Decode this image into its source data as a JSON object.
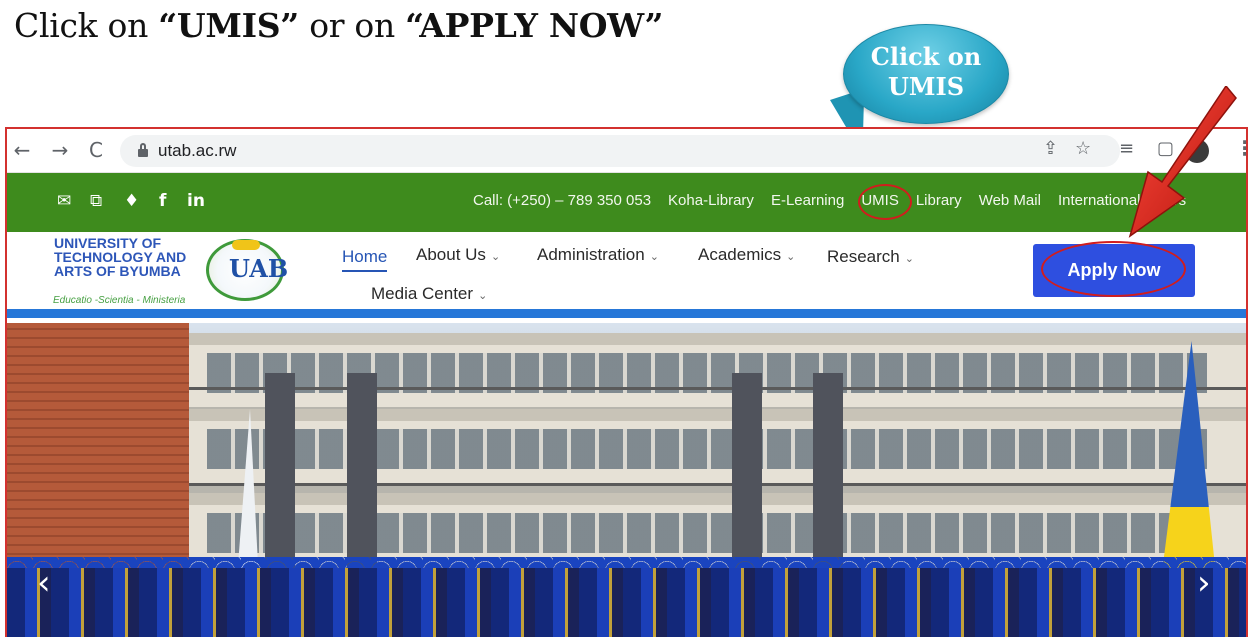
{
  "instruction": {
    "prefix": "Click on ",
    "umis": "“UMIS”",
    "middle": " or on ",
    "apply": "“APPLY NOW”"
  },
  "callout": {
    "line1": "Click on",
    "line2": "UMIS"
  },
  "browser": {
    "back_icon": "←",
    "forward_icon": "→",
    "reload_icon": "C",
    "url": "utab.ac.rw",
    "icons": [
      "share-icon",
      "star-icon",
      "reading-list-icon",
      "side-panel-icon",
      "profile-avatar",
      "menu-kebab-icon"
    ]
  },
  "topbar": {
    "social_icons": [
      "mail-icon",
      "external-link-icon",
      "twitter-icon",
      "facebook-icon",
      "linkedin-icon"
    ],
    "links": [
      "Call: (+250) – 789 350 053",
      "Koha-Library",
      "E-Learning",
      "UMIS",
      "Library",
      "Web Mail",
      "International Affairs"
    ]
  },
  "header": {
    "logo_lines": [
      "UNIVERSITY OF",
      "TECHNOLOGY AND",
      "ARTS OF BYUMBA"
    ],
    "motto": "Educatio -Scientia - Ministeria",
    "seal_text": "UAB",
    "nav": [
      {
        "label": "Home",
        "active": true
      },
      {
        "label": "About Us",
        "dropdown": true
      },
      {
        "label": "Administration",
        "dropdown": true
      },
      {
        "label": "Academics",
        "dropdown": true
      },
      {
        "label": "Research",
        "dropdown": true
      },
      {
        "label": "Media Center",
        "dropdown": true
      }
    ],
    "apply_label": "Apply Now"
  },
  "hero": {
    "prev_icon": "‹",
    "next_icon": "›"
  },
  "colors": {
    "topbar_green": "#3e8b1d",
    "apply_blue": "#2e4fe0",
    "annotation_red": "#d11d1d",
    "callout_cyan": "#29a7c7"
  }
}
